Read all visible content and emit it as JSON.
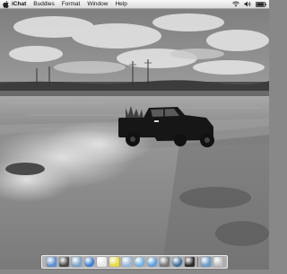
{
  "menubar": {
    "menus": [
      {
        "label": "iChat"
      },
      {
        "label": "Buddies"
      },
      {
        "label": "Format"
      },
      {
        "label": "Window"
      },
      {
        "label": "Help"
      }
    ],
    "tray": [
      "wifi-icon",
      "volume-icon",
      "battery-icon"
    ]
  },
  "desktop": {
    "wallpaper": "black-and-white photo of a pickup truck kicking up dust on a dirt road beside a lake"
  },
  "dock": {
    "apps": [
      {
        "name": "finder-icon",
        "color": "#5d8fd0"
      },
      {
        "name": "dashboard-icon",
        "color": "#4a4a4a"
      },
      {
        "name": "mail-icon",
        "color": "#7fa4c8"
      },
      {
        "name": "safari-icon",
        "color": "#3b7ed6"
      },
      {
        "name": "ical-icon",
        "color": "#e8e8e8"
      },
      {
        "name": "stickies-icon",
        "color": "#e8d84a"
      },
      {
        "name": "preview-icon",
        "color": "#9db8d8"
      },
      {
        "name": "ichat-icon",
        "color": "#6fb3e8"
      },
      {
        "name": "itunes-icon",
        "color": "#5aa0e0"
      },
      {
        "name": "system-preferences-icon",
        "color": "#777777"
      },
      {
        "name": "time-machine-icon",
        "color": "#3c6e9a"
      },
      {
        "name": "app-store-icon",
        "color": "#2c2c2c"
      },
      {
        "name": "documents-folder-icon",
        "color": "#6c99c8"
      },
      {
        "name": "trash-icon",
        "color": "#bcbcbc"
      }
    ]
  }
}
